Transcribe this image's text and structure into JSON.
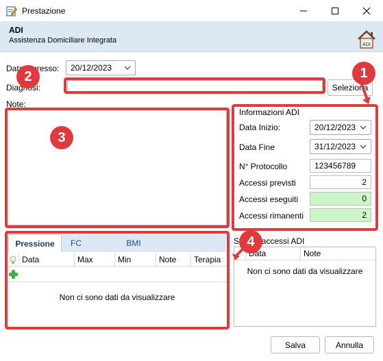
{
  "window": {
    "title": "Prestazione"
  },
  "header": {
    "title": "ADI",
    "subtitle": "Assistenza Domiciliare Integrata",
    "icon_text": "ADI"
  },
  "form": {
    "data_ingresso_label": "Data ingresso:",
    "data_ingresso_value": "20/12/2023",
    "diagnosi_label": "Diagnosi:",
    "diagnosi_value": "",
    "seleziona_label": "Seleziona",
    "note_label": "Note:"
  },
  "info_adi": {
    "title": "Informazioni ADI",
    "data_inizio_label": "Data Inizio:",
    "data_inizio_value": "20/12/2023",
    "data_fine_label": "Data Fine",
    "data_fine_value": "31/12/2023",
    "protocollo_label": "N° Protocollo",
    "protocollo_value": "123456789",
    "accessi_previsti_label": "Accessi previsti",
    "accessi_previsti_value": "2",
    "accessi_eseguiti_label": "Accessi eseguiti",
    "accessi_eseguiti_value": "0",
    "accessi_rimanenti_label": "Accessi rimanenti",
    "accessi_rimanenti_value": "2"
  },
  "vitals": {
    "tabs": [
      "Pressione",
      "FC",
      "BMI"
    ],
    "columns": [
      "Data",
      "Max",
      "Min",
      "Note",
      "Terapia"
    ],
    "empty": "Non ci sono dati da visualizzare"
  },
  "accessi": {
    "title": "Storico accessi ADI",
    "columns": [
      "Data",
      "Note"
    ],
    "empty": "Non ci sono dati da visualizzare"
  },
  "footer": {
    "save_label": "Salva",
    "cancel_label": "Annulla"
  },
  "callouts": [
    "1",
    "2",
    "3",
    "4"
  ],
  "colors": {
    "highlight": "#e0393e",
    "header_band": "#dde8f5",
    "green_field": "#ccf6c8"
  }
}
